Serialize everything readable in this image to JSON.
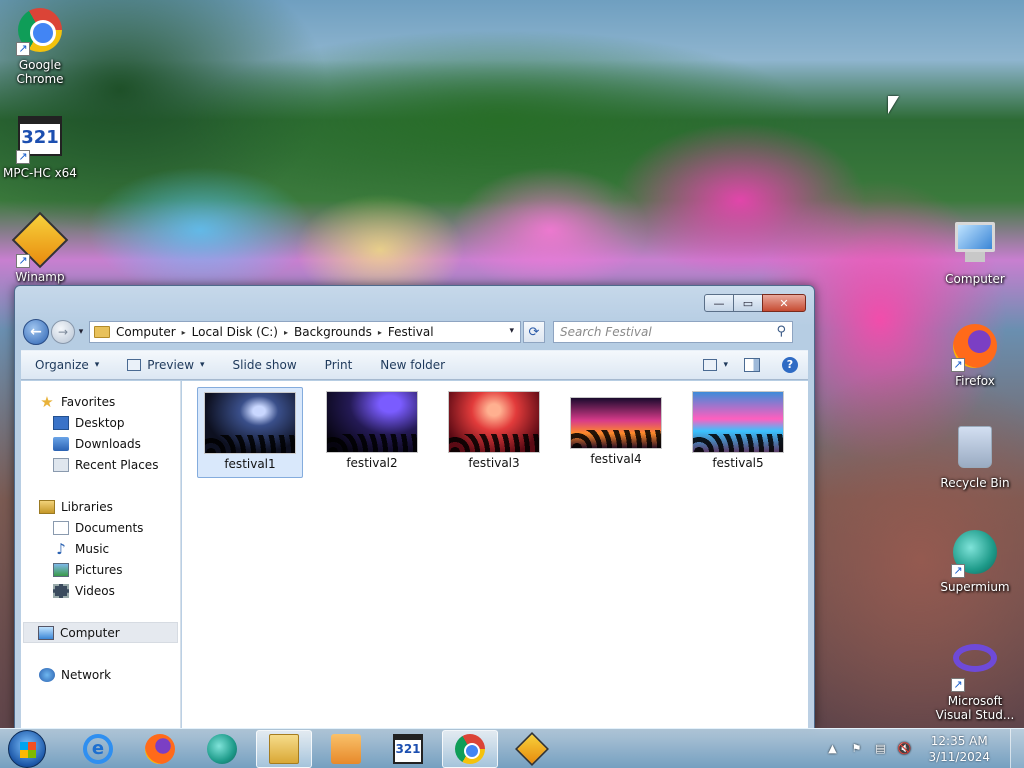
{
  "desktop": {
    "icons": [
      {
        "label": "Google Chrome",
        "icon": "chrome-icon"
      },
      {
        "label": "MPC-HC x64",
        "icon": "mpc-hc-icon"
      },
      {
        "label": "Winamp",
        "icon": "winamp-icon"
      },
      {
        "label": "Computer",
        "icon": "computer-icon"
      },
      {
        "label": "Firefox",
        "icon": "firefox-icon"
      },
      {
        "label": "Recycle Bin",
        "icon": "recycle-bin-icon"
      },
      {
        "label": "Supermium",
        "icon": "supermium-icon"
      },
      {
        "label": "Microsoft Visual Stud...",
        "icon": "visual-studio-icon"
      }
    ],
    "mpc_badge": "321"
  },
  "window": {
    "controls": {
      "minimize": "—",
      "maximize": "▭",
      "close": "✕"
    },
    "nav": {
      "back": "←",
      "forward": "→",
      "dropdown": "▾"
    },
    "breadcrumb": [
      "Computer",
      "Local Disk (C:)",
      "Backgrounds",
      "Festival"
    ],
    "crumb_separator": "▸",
    "address_dropdown": "▾",
    "refresh": "⟳",
    "search_placeholder": "Search Festival",
    "search_icon": "⚲",
    "toolbar": {
      "organize": "Organize",
      "preview": "Preview",
      "slideshow": "Slide show",
      "print": "Print",
      "new_folder": "New folder",
      "caret": "▾",
      "help": "?"
    },
    "navpane": {
      "favorites": "Favorites",
      "desktop": "Desktop",
      "downloads": "Downloads",
      "recent_places": "Recent Places",
      "libraries": "Libraries",
      "documents": "Documents",
      "music": "Music",
      "pictures": "Pictures",
      "videos": "Videos",
      "computer": "Computer",
      "network": "Network"
    },
    "files": [
      "festival1",
      "festival2",
      "festival3",
      "festival4",
      "festival5"
    ],
    "selected_file": "festival1"
  },
  "taskbar": {
    "mpc_badge": "321",
    "ie_letter": "e",
    "tray": {
      "arrow": "▲",
      "flag": "⚑",
      "network": "▤",
      "volume": "🔇"
    },
    "time": "12:35 AM",
    "date": "3/11/2024"
  }
}
